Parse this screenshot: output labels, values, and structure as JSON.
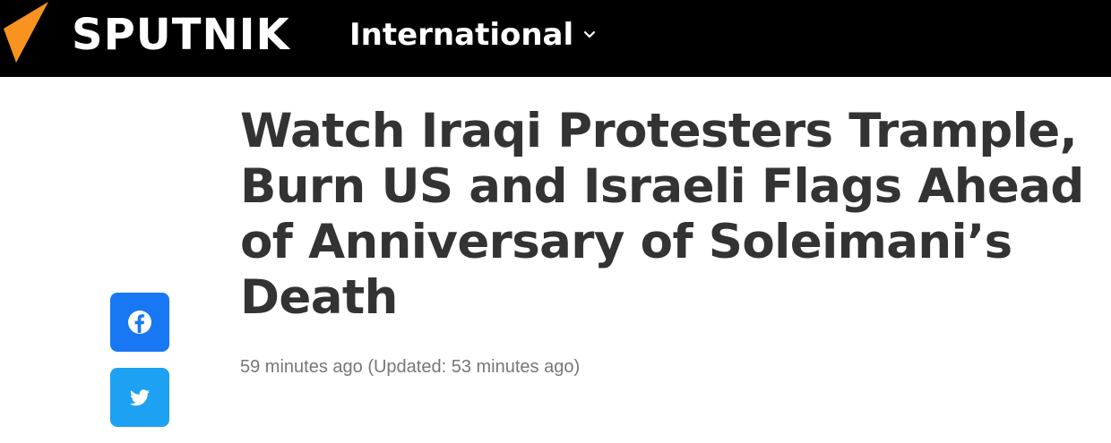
{
  "header": {
    "brand": "SPUTNIK",
    "edition_label": "International",
    "logo_icon": "sputnik-orange-triangle",
    "colors": {
      "bar": "#000000",
      "logo_accent": "#f7931e"
    }
  },
  "article": {
    "title": "Watch Iraqi Protesters Trample, Burn US and Israeli Flags Ahead of Anniversary of Soleimani’s Death",
    "published": "59 minutes ago",
    "updated": "(Updated: 53 minutes ago)"
  },
  "share": {
    "buttons": [
      {
        "icon": "facebook-icon",
        "color": "#1877f2"
      },
      {
        "icon": "twitter-icon",
        "color": "#1da1f2"
      }
    ]
  }
}
